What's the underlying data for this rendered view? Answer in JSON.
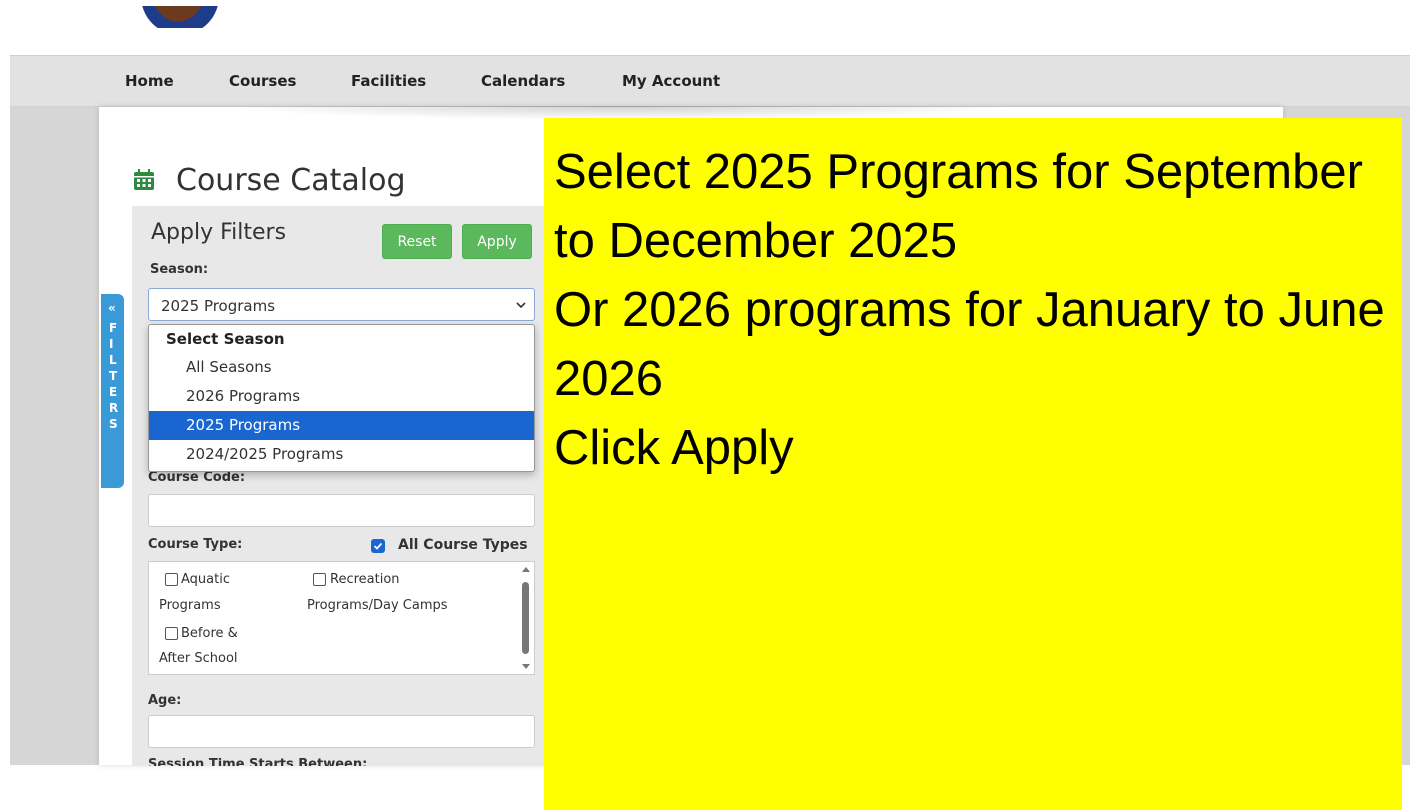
{
  "nav": {
    "items": [
      "Home",
      "Courses",
      "Facilities",
      "Calendars",
      "My Account"
    ]
  },
  "page": {
    "title": "Course Catalog",
    "icon": "calendar-icon"
  },
  "filters": {
    "heading": "Apply Filters",
    "reset_label": "Reset",
    "apply_label": "Apply",
    "season_label": "Season:",
    "season_value": "2025 Programs",
    "season_options_group": "Select Season",
    "season_options": [
      "All Seasons",
      "2026 Programs",
      "2025 Programs",
      "2024/2025 Programs"
    ],
    "course_code_label": "Course Code:",
    "course_type_label": "Course Type:",
    "all_course_types_label": "All Course Types",
    "all_course_types_checked": true,
    "course_types": [
      {
        "line1": "Aquatic",
        "line2": "Programs"
      },
      {
        "line1": "Recreation",
        "line2": "Programs/Day Camps"
      },
      {
        "line1": "Before &",
        "line2": "After School"
      }
    ],
    "age_label": "Age:",
    "session_time_label": "Session Time Starts Between:",
    "side_tab_label": "FILTERS",
    "side_tab_chevron": "«"
  },
  "note": {
    "lines": [
      "Select 2025 Programs for September to December 2025",
      "Or 2026 programs for January to June 2026",
      "Click Apply"
    ]
  },
  "colors": {
    "button_green": "#5cb85c",
    "highlight_blue": "#1a66d0",
    "note_yellow": "#ffff00",
    "tab_blue": "#3a9ad8"
  }
}
